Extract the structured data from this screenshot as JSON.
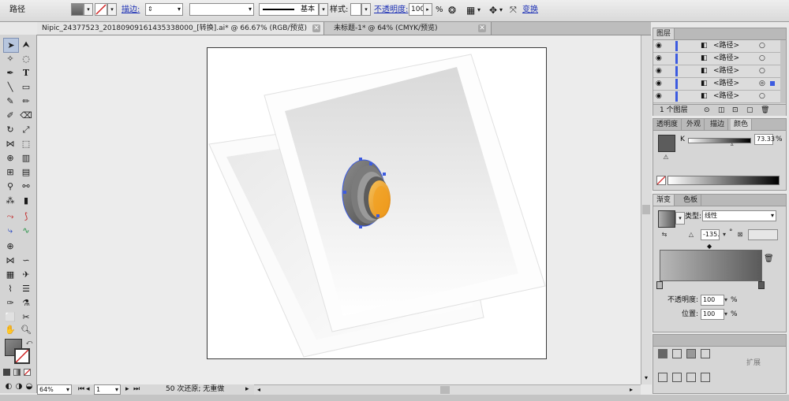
{
  "control_bar": {
    "object_type": "路径",
    "stroke_label": "描边:",
    "stroke_profile": "基本",
    "style_label": "样式:",
    "opacity_label": "不透明度:",
    "opacity_value": "100",
    "opacity_unit": "%",
    "transform_label": "变换"
  },
  "tabs": [
    {
      "label": "Nipic_24377523_20180909161435338000_[转换].ai* @ 66.67% (RGB/预览)",
      "close": "✕"
    },
    {
      "label": "未标题-1* @ 64% (CMYK/预览)",
      "close": "✕"
    }
  ],
  "status": {
    "zoom": "64%",
    "page": "1",
    "info": "50 次还原; 无重做"
  },
  "layers_panel": {
    "title": "图层",
    "rows": [
      "<路径>",
      "<路径>",
      "<路径>",
      "<路径>",
      "<路径>"
    ],
    "footer": "1 个图层"
  },
  "color_panel": {
    "tabs": [
      "透明度",
      "外观",
      "描边",
      "颜色"
    ],
    "channel_label": "K",
    "channel_value": "73.33",
    "channel_unit": "%"
  },
  "gradient_panel": {
    "tabs": [
      "渐变",
      "色板"
    ],
    "type_label": "类型:",
    "type_value": "线性",
    "angle_value": "-135.",
    "angle_unit": "°",
    "opacity_label": "不透明度:",
    "opacity_value": "100",
    "opacity_unit": "%",
    "position_label": "位置:",
    "position_value": "100",
    "position_unit": "%"
  },
  "bottom_panel": {
    "labels": [
      "扩展"
    ]
  },
  "colors": {
    "artboard_bg": "#ffffff",
    "orange": "#f2a020",
    "gray_fill": "#6a6a6a",
    "selection": "#3c5be0",
    "link": "#1b2fb5"
  }
}
